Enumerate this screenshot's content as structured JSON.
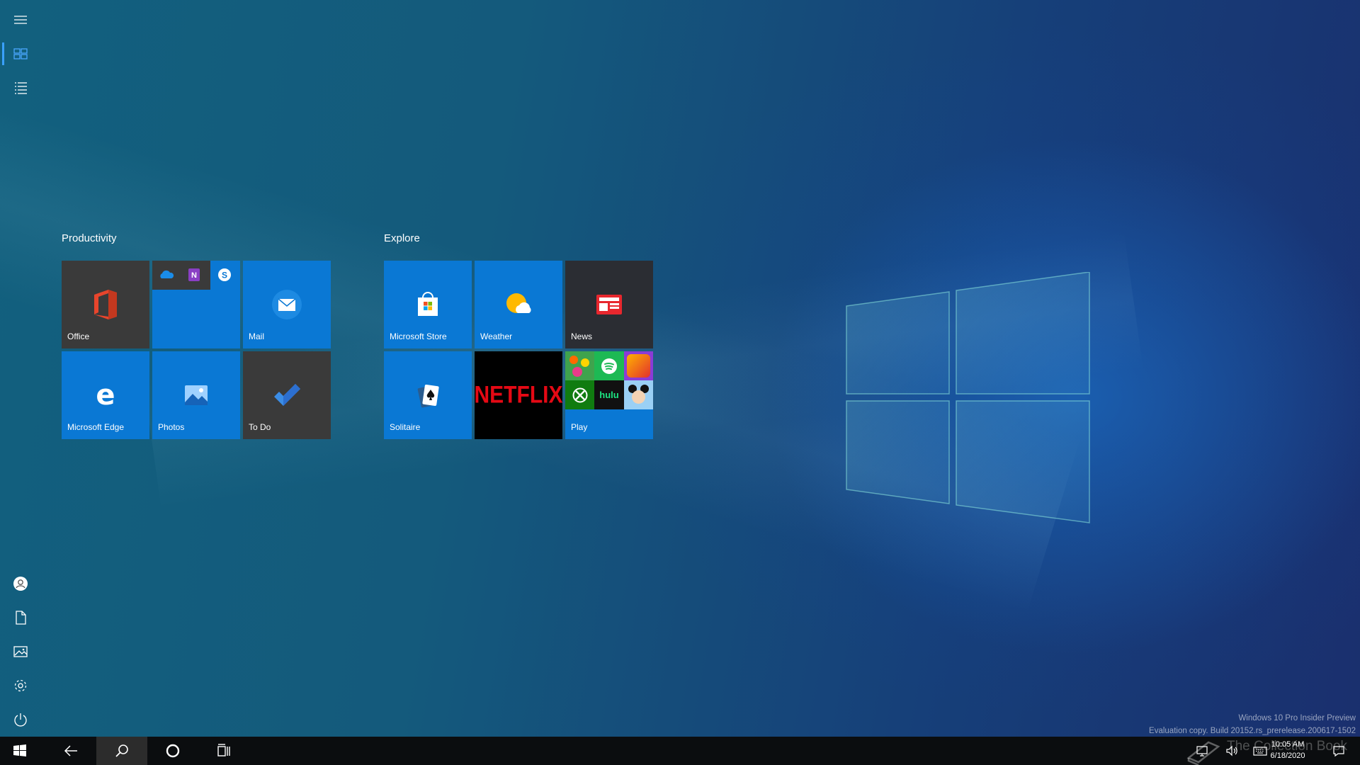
{
  "start": {
    "groups": [
      {
        "title": "Productivity",
        "tiles": [
          {
            "label": "Office",
            "icon": "office-icon"
          },
          {
            "label": "",
            "icon": "office-apps-folder-icon"
          },
          {
            "label": "Mail",
            "icon": "mail-icon"
          },
          {
            "label": "Microsoft Edge",
            "icon": "edge-icon"
          },
          {
            "label": "Photos",
            "icon": "photos-icon"
          },
          {
            "label": "To Do",
            "icon": "todo-icon"
          }
        ]
      },
      {
        "title": "Explore",
        "tiles": [
          {
            "label": "Microsoft Store",
            "icon": "store-icon"
          },
          {
            "label": "Weather",
            "icon": "weather-icon"
          },
          {
            "label": "News",
            "icon": "news-icon"
          },
          {
            "label": "Solitaire",
            "icon": "solitaire-icon"
          },
          {
            "label": "NETFLIX",
            "icon": "netflix-logo"
          },
          {
            "label": "Play",
            "icon": "play-folder-icon"
          }
        ]
      }
    ],
    "folder_apps": {
      "productivity": [
        "onedrive-icon",
        "onenote-icon",
        "skype-icon"
      ],
      "play": [
        "candy-crush-icon",
        "spotify-icon",
        "friends-game-icon",
        "xbox-icon",
        "hulu",
        "disney-icon"
      ]
    }
  },
  "rail": {
    "top": [
      "menu-icon",
      "pinned-tiles-icon",
      "all-apps-list-icon"
    ],
    "bottom": [
      "user-icon",
      "documents-icon",
      "pictures-icon",
      "settings-icon",
      "power-icon"
    ]
  },
  "taskbar": {
    "buttons": [
      "windows-start-icon",
      "back-arrow-icon",
      "search-icon",
      "cortana-icon",
      "task-view-icon"
    ],
    "tray": [
      "network-icon",
      "volume-icon",
      "keyboard-icon",
      "notification-icon"
    ],
    "clock": {
      "time": "10:05 AM",
      "date": "6/18/2020"
    }
  },
  "watermark": {
    "line1": "Windows 10 Pro Insider Preview",
    "line2": "Evaluation copy. Build 20152.rs_prerelease.200617-1502"
  },
  "overlay_brand": "The Collection Book",
  "colors": {
    "tile_blue": "#0a78d4",
    "tile_dark": "#3a3a3a",
    "taskbar": "#0b0d0f",
    "accent": "#3aa0ff"
  }
}
